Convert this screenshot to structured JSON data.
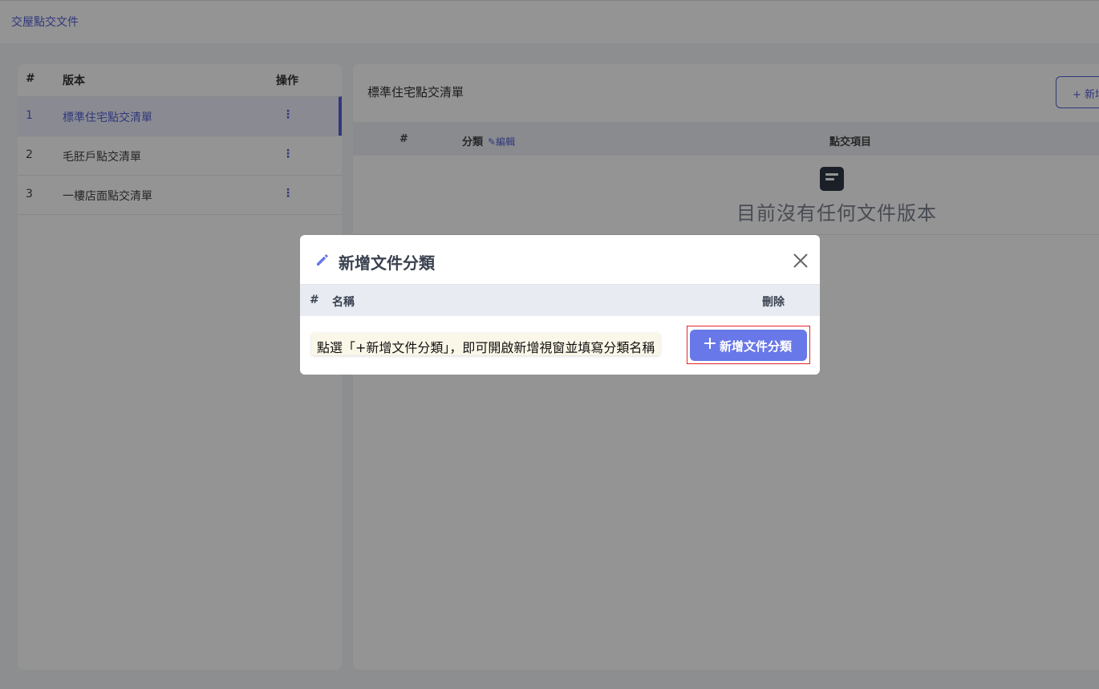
{
  "topbar": {
    "breadcrumb": "交屋點交文件"
  },
  "left_panel": {
    "headers": {
      "num": "#",
      "name": "版本",
      "op": "操作"
    },
    "rows": [
      {
        "num": "1",
        "name": "標準住宅點交清單",
        "active": true
      },
      {
        "num": "2",
        "name": "毛胚戶點交清單",
        "active": false
      },
      {
        "num": "3",
        "name": "一樓店面點交清單",
        "active": false
      }
    ],
    "kebab": "⋮"
  },
  "right_panel": {
    "title": "標準住宅點交清單",
    "add_label": "+ 新增",
    "table_headers": {
      "num": "#",
      "category": "分類",
      "edit": "✎編輯",
      "item": "點交項目"
    },
    "empty_text": "目前沒有任何文件版本"
  },
  "modal": {
    "title": "新增文件分類",
    "table_headers": {
      "num": "#",
      "name": "名稱",
      "delete": "刪除"
    },
    "hint": "點選「+新增文件分類」，即可開啟新增視窗並填寫分類名稱",
    "add_button_label": "新增文件分類"
  },
  "colors": {
    "accent": "#5561d6",
    "button": "#6878e8",
    "highlight_box": "#e0242e",
    "hint_background": "#fbf7e8"
  }
}
